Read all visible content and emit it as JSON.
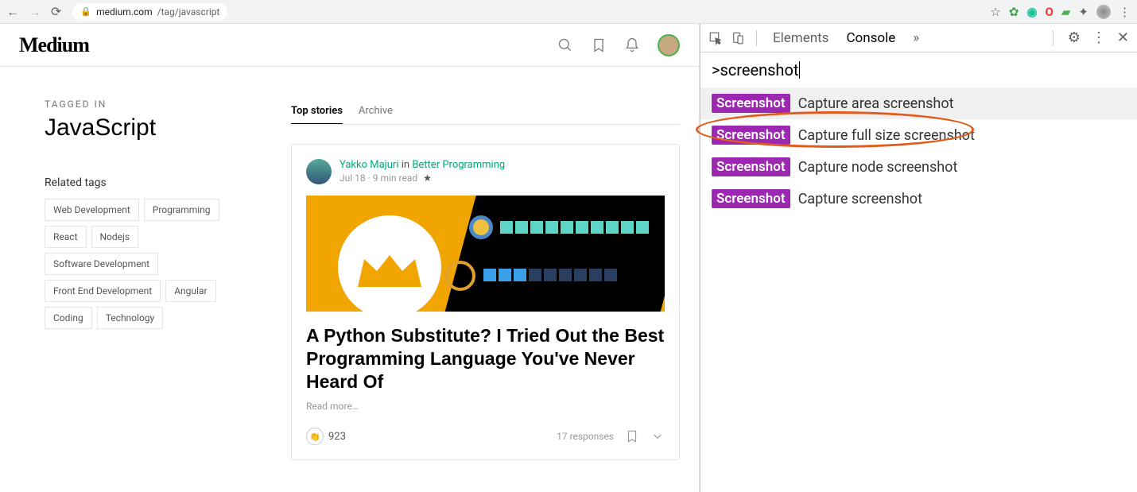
{
  "browser": {
    "url_host": "medium.com",
    "url_path": "/tag/javascript"
  },
  "medium": {
    "logo": "Medium",
    "tagged_in": "TAGGED IN",
    "tag_title": "JavaScript",
    "related_label": "Related tags",
    "related_tags": [
      "Web Development",
      "Programming",
      "React",
      "Nodejs",
      "Software Development",
      "Front End Development",
      "Angular",
      "Coding",
      "Technology"
    ],
    "tabs": {
      "top": "Top stories",
      "archive": "Archive"
    },
    "story": {
      "author": "Yakko Majuri",
      "in": "in",
      "publication": "Better Programming",
      "date": "Jul 18",
      "read_time": "9 min read",
      "title": "A Python Substitute? I Tried Out the Best Programming Language You've Never Heard Of",
      "read_more": "Read more…",
      "claps": "923",
      "responses": "17 responses"
    }
  },
  "devtools": {
    "tabs": {
      "elements": "Elements",
      "console": "Console"
    },
    "more": "»",
    "cmd_prefix": ">",
    "cmd_query": "screenshot",
    "cmd_badge": "Screenshot",
    "suggestions": [
      "Capture area screenshot",
      "Capture full size screenshot",
      "Capture node screenshot",
      "Capture screenshot"
    ]
  }
}
